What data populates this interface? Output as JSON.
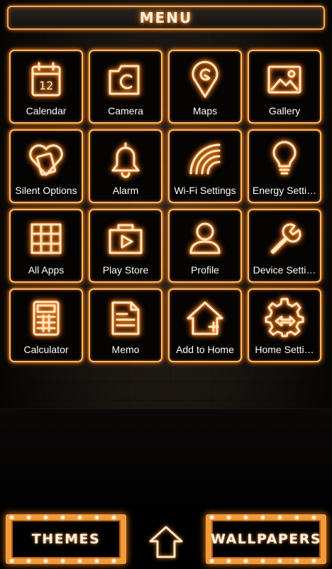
{
  "header": {
    "title": "MENU"
  },
  "tiles": [
    {
      "label": "Calendar",
      "icon": "calendar-icon",
      "day": "12"
    },
    {
      "label": "Camera",
      "icon": "camera-icon"
    },
    {
      "label": "Maps",
      "icon": "map-pin-icon"
    },
    {
      "label": "Gallery",
      "icon": "image-icon"
    },
    {
      "label": "Silent Options",
      "icon": "heart-phone-icon"
    },
    {
      "label": "Alarm",
      "icon": "bell-icon"
    },
    {
      "label": "Wi-Fi Settings",
      "icon": "wifi-icon"
    },
    {
      "label": "Energy Setti…",
      "icon": "lightbulb-icon"
    },
    {
      "label": "All Apps",
      "icon": "grid-icon"
    },
    {
      "label": "Play Store",
      "icon": "play-bag-icon"
    },
    {
      "label": "Profile",
      "icon": "person-icon"
    },
    {
      "label": "Device Setti…",
      "icon": "wrench-icon"
    },
    {
      "label": "Calculator",
      "icon": "calculator-icon"
    },
    {
      "label": "Memo",
      "icon": "document-icon"
    },
    {
      "label": "Add to Home",
      "icon": "home-plus-icon"
    },
    {
      "label": "Home Setti…",
      "icon": "gear-icon"
    }
  ],
  "bottom": {
    "themes_label": "THEMES",
    "wallpapers_label": "WALLPAPERS",
    "home_icon": "home-outline-icon"
  },
  "colors": {
    "accent": "#ff8a1c",
    "glow_text": "#ffe7c7",
    "button_frame": "#f19a3a"
  }
}
